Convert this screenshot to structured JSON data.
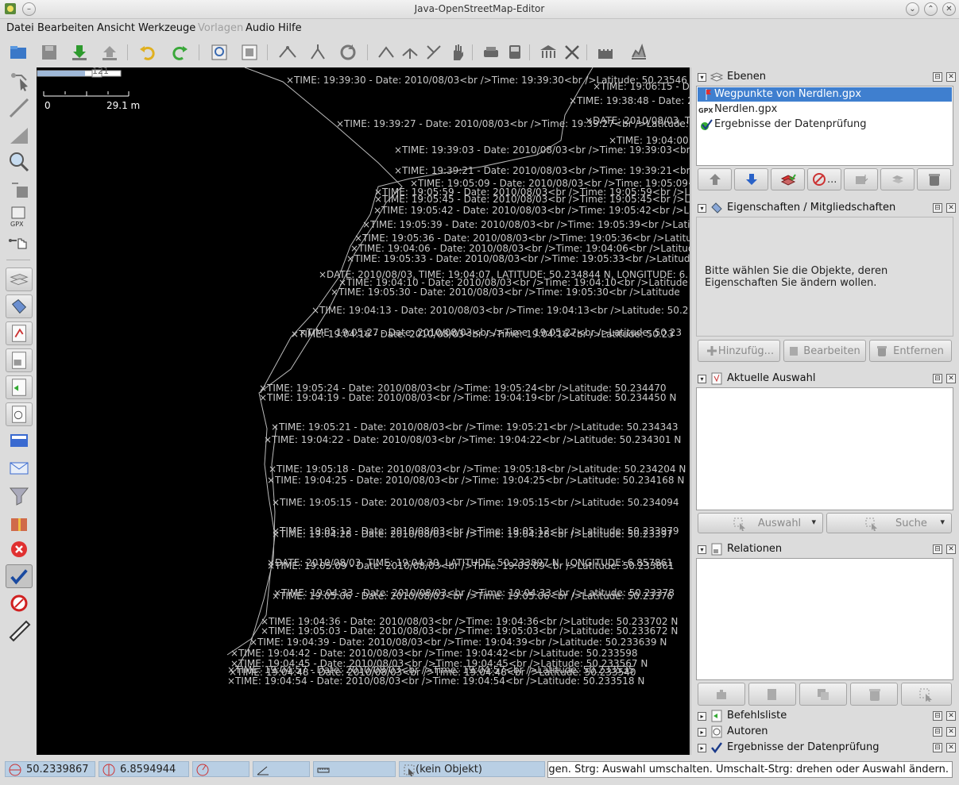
{
  "window": {
    "title": "Java-OpenStreetMap-Editor"
  },
  "menu": [
    "Datei",
    "Bearbeiten",
    "Ansicht",
    "Werkzeuge",
    "Vorlagen",
    "Audio",
    "Hilfe"
  ],
  "map": {
    "scale": {
      "zero": "0",
      "distance": "29.1 m",
      "top": "121"
    },
    "labels": [
      "TIME: 19:39:30 - Date: 2010/08/03<br />Time: 19:39:30<br />Latitude: 50.23546",
      "TIME: 19:06:15 - Date: 20",
      "TIME: 19:38:48 - Date: 2",
      "TIME: 19:39:27 - Date: 2010/08/03<br />Time: 19:39:27<br />Latitude: 50",
      "DATE: 2010/08/03, TIME",
      "TIME: 19:04:00",
      "TIME: 19:39:03 - Date: 2010/08/03<br />Time: 19:39:03<br />Latitude",
      "TIME: 19:39:21 - Date: 2010/08/03<br />Time: 19:39:21<br />Latitude",
      "TIME: 19:05:09 - Date: 2010/08/03<br />Time: 19:05:09<br />Latitude",
      "TIME: 19:05:59 - Date: 2010/08/03<br />Time: 19:05:59<br />Latitude",
      "TIME: 19:05:45 - Date: 2010/08/03<br />Time: 19:05:45<br />Latitude",
      "TIME: 19:05:42 - Date: 2010/08/03<br />Time: 19:05:42<br />Latitude",
      "TIME: 19:05:39 - Date: 2010/08/03<br />Time: 19:05:39<br />Latitude",
      "TIME: 19:05:36 - Date: 2010/08/03<br />Time: 19:05:36<br />Latitude",
      "TIME: 19:04:06 - Date: 2010/08/03<br />Time: 19:04:06<br />Latitude",
      "TIME: 19:05:33 - Date: 2010/08/03<br />Time: 19:05:33<br />Latitude",
      "DATE: 2010/08/03, TIME: 19:04:07, LATITUDE: 50.234844 N, LONGITUDE: 6.",
      "TIME: 19:04:10 - Date: 2010/08/03<br />Time: 19:04:10<br />Latitude",
      "TIME: 19:05:30 - Date: 2010/08/03<br />Time: 19:05:30<br />Latitude",
      "TIME: 19:04:13 - Date: 2010/08/03<br />Time: 19:04:13<br />Latitude: 50.2",
      "TIME: 19:05:27 - Date: 2010/08/03<br />Time: 19:05:27<br />Latitude: 50.23",
      "TIME: 19:04:16 - Date: 2010/08/03<br />Time: 19:04:16<br />Latitude: 50.23",
      "TIME: 19:05:24 - Date: 2010/08/03<br />Time: 19:05:24<br />Latitude: 50.234470",
      "TIME: 19:04:19 - Date: 2010/08/03<br />Time: 19:04:19<br />Latitude: 50.234450 N",
      "TIME: 19:05:21 - Date: 2010/08/03<br />Time: 19:05:21<br />Latitude: 50.234343",
      "TIME: 19:04:22 - Date: 2010/08/03<br />Time: 19:04:22<br />Latitude: 50.234301 N",
      "TIME: 19:05:18 - Date: 2010/08/03<br />Time: 19:05:18<br />Latitude: 50.234204 N",
      "TIME: 19:04:25 - Date: 2010/08/03<br />Time: 19:04:25<br />Latitude: 50.234168 N",
      "TIME: 19:05:15 - Date: 2010/08/03<br />Time: 19:05:15<br />Latitude: 50.234094",
      "TIME: 19:05:12 - Date: 2010/08/03<br />Time: 19:05:12<br />Latitude: 50.233979",
      "TIME: 19:04:28 - Date: 2010/08/03<br />Time: 19:04:28<br />Latitude: 50.23397",
      "DATE: 2010/08/03, TIME: 19:04:30, LATITUDE: 50.233897 N, LONGITUDE: 6.857861",
      "TIME: 19:05:09 - Date: 2010/08/03<br />Time: 19:05:09<br />Latitude: 50.233861",
      "TIME: 19:04:33 - Date: 2010/08/03<br />Time: 19:04:33<br />Latitude: 50.23378",
      "TIME: 19:05:06 - Date: 2010/08/03<br />Time: 19:05:06<br />Latitude: 50.23376",
      "TIME: 19:04:36 - Date: 2010/08/03<br />Time: 19:04:36<br />Latitude: 50.233702 N",
      "TIME: 19:05:03 - Date: 2010/08/03<br />Time: 19:05:03<br />Latitude: 50.233672 N",
      "TIME: 19:04:39 - Date: 2010/08/03<br />Time: 19:04:39<br />Latitude: 50.233639 N",
      "TIME: 19:04:42 - Date: 2010/08/03<br />Time: 19:04:42<br />Latitude: 50.233598",
      "TIME: 19:04:45 - Date: 2010/08/03<br />Time: 19:04:45<br />Latitude: 50.233567 N",
      "TIME: 19:04:57 - Date: 2010/08/03<br />Time: 19:04:57<br />Latitude: 50.233535",
      "TIME: 19:04:48 - Date: 2010/08/03<br />Time: 19:04:48<br />Latitude: 50.233540",
      "TIME: 19:04:54 - Date: 2010/08/03<br />Time: 19:04:54<br />Latitude: 50.233518 N"
    ]
  },
  "panels": {
    "layers": {
      "title": "Ebenen",
      "items": [
        "Wegpunkte von Nerdlen.gpx",
        "Nerdlen.gpx",
        "Ergebnisse der Datenprüfung"
      ]
    },
    "properties": {
      "title": "Eigenschaften / Mitgliedschaften",
      "message_line1": "Bitte wählen Sie die Objekte, deren",
      "message_line2": "Eigenschaften Sie ändern wollen.",
      "buttons": [
        "Hinzufüg...",
        "Bearbeiten",
        "Entfernen"
      ]
    },
    "selection": {
      "title": "Aktuelle Auswahl",
      "buttons": [
        "Auswahl",
        "Suche"
      ]
    },
    "relations": {
      "title": "Relationen"
    },
    "commands": {
      "title": "Befehlsliste"
    },
    "authors": {
      "title": "Autoren"
    },
    "validation": {
      "title": "Ergebnisse der Datenprüfung"
    }
  },
  "layers_toolbar_overflow": "...",
  "status": {
    "lat": "50.2339867",
    "lon": "6.8594944",
    "object": "(kein Objekt)",
    "hint": "ügen. Strg: Auswahl umschalten. Umschalt-Strg: drehen oder Auswahl ändern."
  },
  "icons": {
    "toolbar": [
      "open-icon",
      "save-icon",
      "download-icon",
      "upload-icon",
      "undo-icon",
      "redo-icon",
      "preferences-icon",
      "layer-list-icon",
      "split-way-icon",
      "combine-way-icon",
      "refresh-icon",
      "align-circle-icon",
      "align-line-icon",
      "orthogonalize-icon",
      "hand-icon",
      "car-icon",
      "bus-icon",
      "building-icon",
      "cross-icon",
      "castle-icon",
      "chart-icon"
    ],
    "left": [
      "select-tool-icon",
      "draw-tool-icon",
      "improve-way-icon",
      "zoom-tool-icon",
      "delete-tool-icon",
      "gpx-icon",
      "move-icon",
      "layers-panel-icon",
      "properties-panel-icon",
      "relations-panel-icon",
      "selection-panel-icon",
      "history-panel-icon",
      "filter-panel-icon",
      "notes-icon",
      "mail-icon",
      "funnel-icon",
      "gift-icon",
      "error-icon",
      "validation-check-icon",
      "no-entry-icon",
      "measure-icon"
    ]
  }
}
